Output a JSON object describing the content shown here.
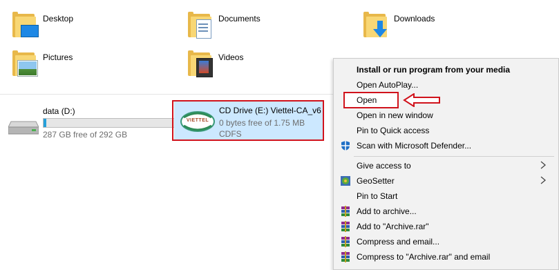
{
  "folders": [
    {
      "label": "Desktop",
      "icon": "desktop-folder-icon"
    },
    {
      "label": "Documents",
      "icon": "documents-folder-icon"
    },
    {
      "label": "Downloads",
      "icon": "downloads-folder-icon"
    },
    {
      "label": "Pictures",
      "icon": "pictures-folder-icon"
    },
    {
      "label": "Videos",
      "icon": "videos-folder-icon"
    }
  ],
  "drives": {
    "data": {
      "name": "data (D:)",
      "free": "287 GB free of 292 GB",
      "used_fraction": 0.02,
      "icon": "hard-drive-icon"
    },
    "cd": {
      "name": "CD Drive (E:) Viettel-CA_v6",
      "free": "0 bytes free of 1.75 MB",
      "fs": "CDFS",
      "icon": "viettel-cd-icon",
      "logo_text": "VIETTEL"
    }
  },
  "context_menu": {
    "items": [
      {
        "label": "Install or run program from your media",
        "bold": true
      },
      {
        "label": "Open AutoPlay..."
      },
      {
        "label": "Open"
      },
      {
        "label": "Open in new window"
      },
      {
        "label": "Pin to Quick access"
      },
      {
        "label": "Scan with Microsoft Defender...",
        "icon": "defender-shield-icon"
      },
      {
        "label": "Give access to",
        "submenu": true
      },
      {
        "label": "GeoSetter",
        "submenu": true,
        "icon": "geosetter-icon"
      },
      {
        "label": "Pin to Start"
      },
      {
        "label": "Add to archive...",
        "icon": "winrar-icon"
      },
      {
        "label": "Add to \"Archive.rar\"",
        "icon": "winrar-icon"
      },
      {
        "label": "Compress and email...",
        "icon": "winrar-icon"
      },
      {
        "label": "Compress to \"Archive.rar\" and email",
        "icon": "winrar-icon"
      }
    ]
  },
  "colors": {
    "selection": "#cce8ff",
    "highlight_red": "#d0121b",
    "drive_fill": "#26a0da",
    "menu_bg": "#f2f2f2"
  }
}
